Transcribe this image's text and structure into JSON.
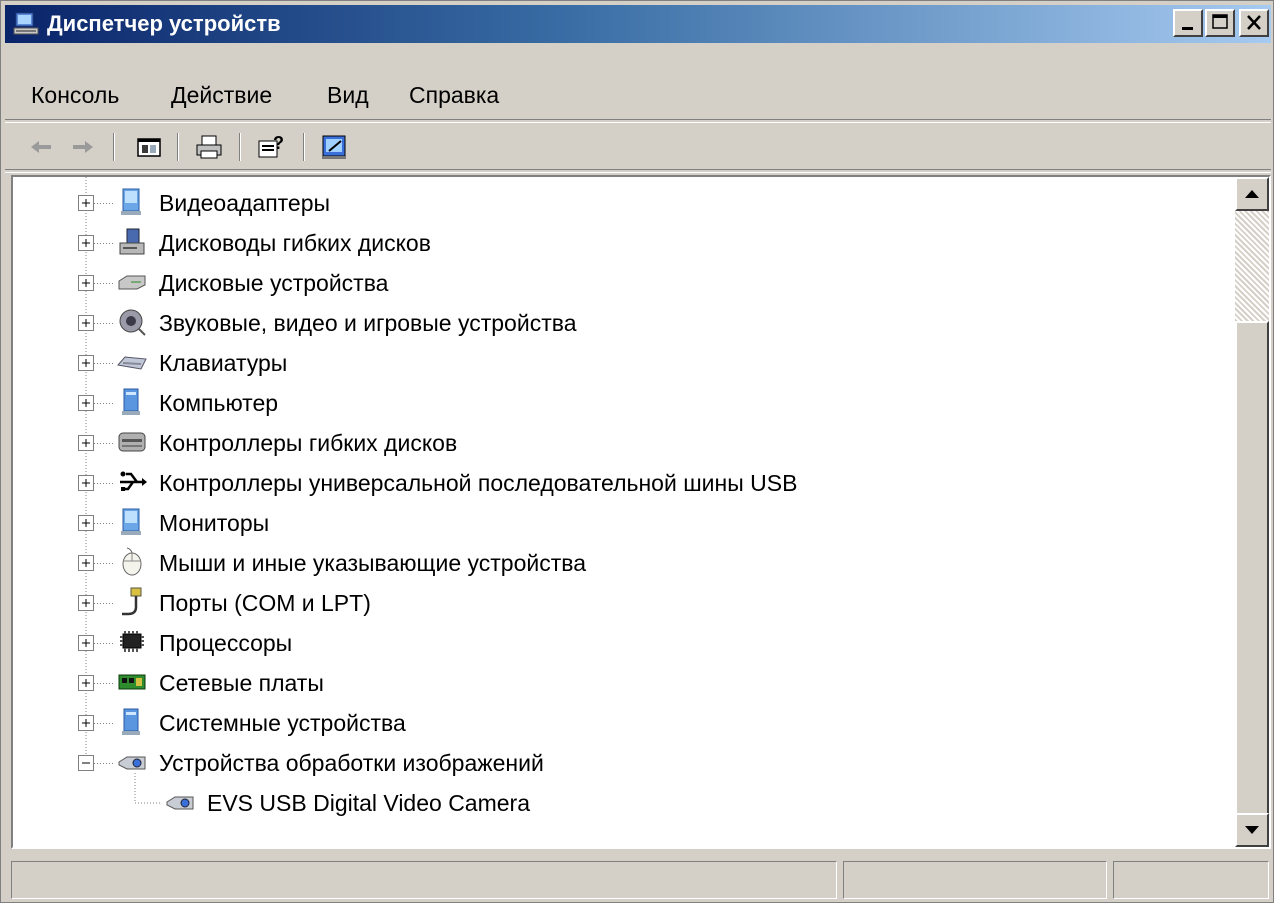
{
  "window": {
    "title": "Диспетчер устройств"
  },
  "menu": [
    "Консоль",
    "Действие",
    "Вид",
    "Справка"
  ],
  "toolbar": {
    "buttons": [
      "back-icon",
      "forward-icon",
      "show-hide-console-tree-icon",
      "print-icon",
      "help-icon",
      "scan-hardware-icon"
    ]
  },
  "tree": {
    "items": [
      {
        "label": "Видеоадаптеры",
        "icon": "display-adapter-icon",
        "expanded": false
      },
      {
        "label": "Дисководы гибких дисков",
        "icon": "floppy-drive-icon",
        "expanded": false
      },
      {
        "label": "Дисковые устройства",
        "icon": "disk-drive-icon",
        "expanded": false
      },
      {
        "label": "Звуковые, видео и игровые устройства",
        "icon": "sound-device-icon",
        "expanded": false
      },
      {
        "label": "Клавиатуры",
        "icon": "keyboard-icon",
        "expanded": false
      },
      {
        "label": "Компьютер",
        "icon": "computer-icon",
        "expanded": false
      },
      {
        "label": "Контроллеры гибких дисков",
        "icon": "floppy-controller-icon",
        "expanded": false
      },
      {
        "label": "Контроллеры универсальной последовательной шины USB",
        "icon": "usb-icon",
        "expanded": false
      },
      {
        "label": "Мониторы",
        "icon": "monitor-icon",
        "expanded": false
      },
      {
        "label": "Мыши и иные указывающие устройства",
        "icon": "mouse-icon",
        "expanded": false
      },
      {
        "label": "Порты (COM и LPT)",
        "icon": "port-icon",
        "expanded": false
      },
      {
        "label": "Процессоры",
        "icon": "processor-icon",
        "expanded": false
      },
      {
        "label": "Сетевые платы",
        "icon": "network-card-icon",
        "expanded": false
      },
      {
        "label": "Системные устройства",
        "icon": "system-device-icon",
        "expanded": false
      },
      {
        "label": "Устройства обработки изображений",
        "icon": "imaging-device-icon",
        "expanded": true,
        "children": [
          {
            "label": "EVS USB Digital Video Camera",
            "icon": "camera-icon"
          }
        ]
      }
    ]
  },
  "statusbar": {
    "cells": [
      "",
      "",
      ""
    ]
  },
  "colors": {
    "title_start": "#0a246a",
    "title_end": "#a6caf0",
    "face": "#d4d0c8"
  }
}
